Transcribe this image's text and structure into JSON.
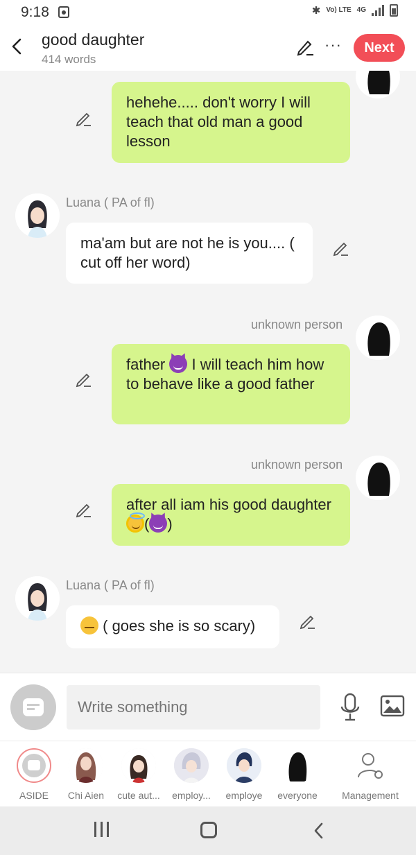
{
  "status_bar": {
    "time": "9:18",
    "network": "Vo) LTE",
    "net_type": "4G"
  },
  "header": {
    "title": "good daughter",
    "word_count": "414 words",
    "next_label": "Next"
  },
  "messages": [
    {
      "side": "right",
      "text": "hehehe..... don't worry I will teach that old man a good lesson"
    },
    {
      "side": "left",
      "speaker": "Luana ( PA of fl)",
      "text": "ma'am but are not he is you.... ( cut off her word)"
    },
    {
      "side": "right",
      "speaker": "unknown person",
      "text_a": "father",
      "emoji_a": "smiling-devil",
      "text_b": "I will teach him how to behave like a good father"
    },
    {
      "side": "right",
      "speaker": "unknown person",
      "text_a": "after all iam his good daughter",
      "emoji_a": "angel",
      "text_b": "(",
      "emoji_b": "smiling-devil",
      "text_c": ")"
    },
    {
      "side": "left",
      "speaker": "Luana ( PA of fl)",
      "emoji_a": "confounded",
      "text_a": "( goes she is so scary)"
    }
  ],
  "input": {
    "placeholder": "Write something"
  },
  "characters": [
    {
      "label": "ASIDE"
    },
    {
      "label": "Chi Aien"
    },
    {
      "label": "cute aut..."
    },
    {
      "label": "employ..."
    },
    {
      "label": "employe"
    },
    {
      "label": "everyone"
    },
    {
      "label": "Management"
    }
  ],
  "colors": {
    "accent": "#f24e57",
    "bubble_right": "#d6f58d",
    "bubble_left": "#ffffff"
  }
}
